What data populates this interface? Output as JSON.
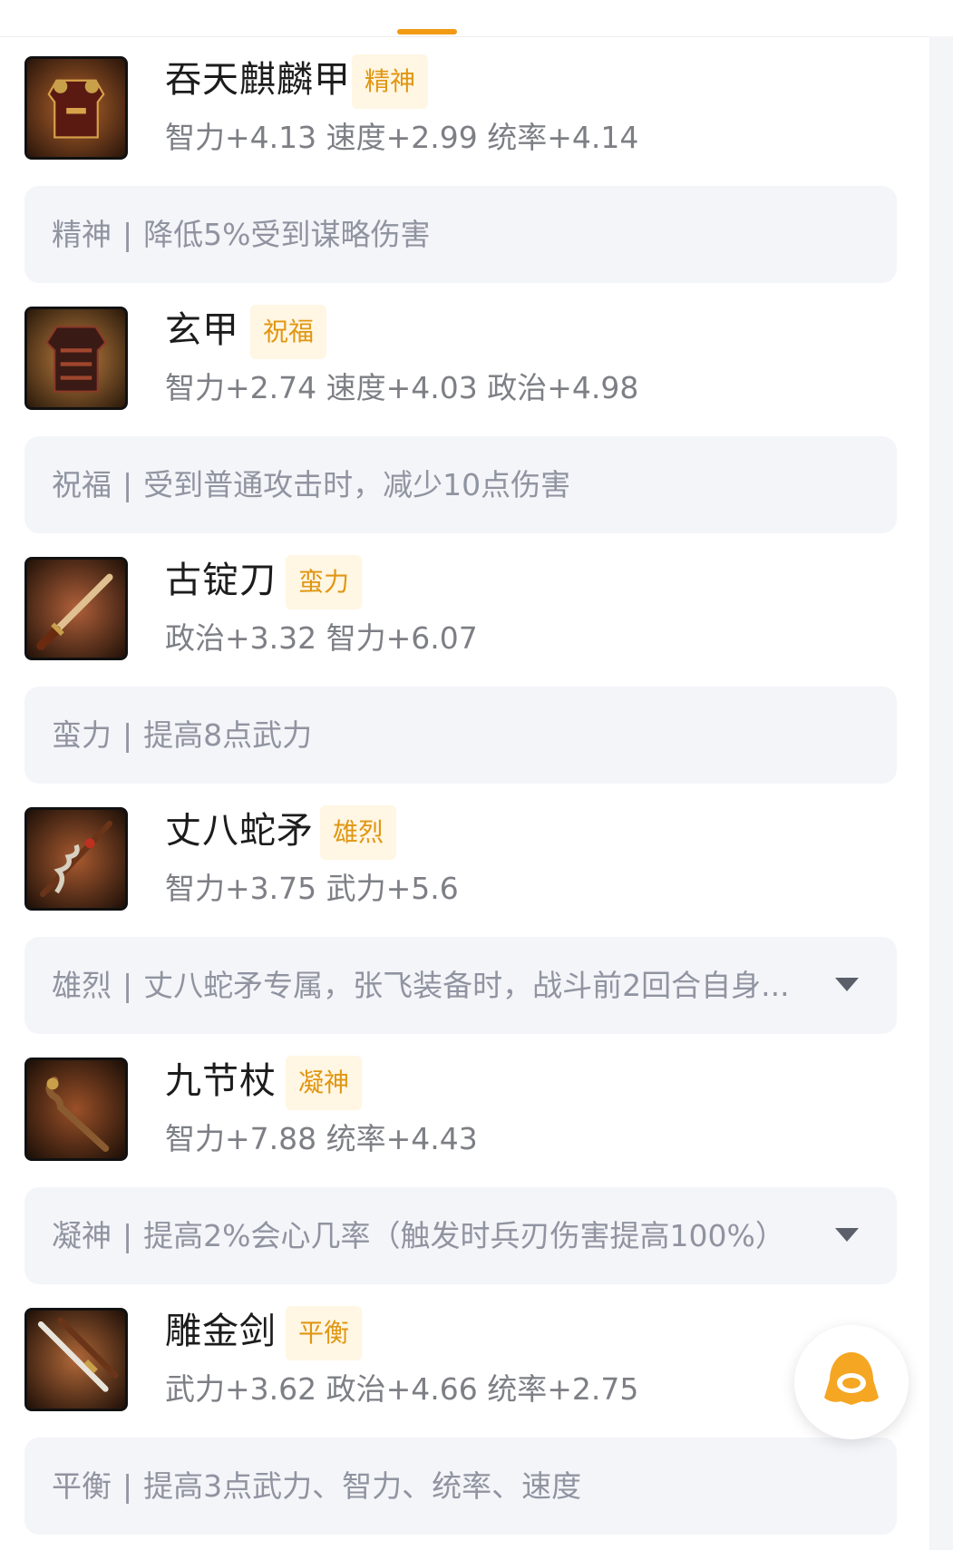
{
  "colors": {
    "accent": "#f29a12",
    "badge_bg": "#fff6e3",
    "badge_text": "#e09612",
    "desc_bg": "#f3f5f9",
    "stat_text": "#7d7f85",
    "title_text": "#1c1c1c"
  },
  "items": [
    {
      "name": "吞天麒麟甲",
      "badge": "精神",
      "stats": "智力+4.13 速度+2.99 统率+4.14",
      "desc_label": "精神",
      "desc_text": "降低5%受到谋略伤害",
      "icon": "armor-icon",
      "expandable": false
    },
    {
      "name": "玄甲",
      "badge": "祝福",
      "stats": "智力+2.74 速度+4.03 政治+4.98",
      "desc_label": "祝福",
      "desc_text": "受到普通攻击时，减少10点伤害",
      "icon": "armor-icon",
      "expandable": false
    },
    {
      "name": "古锭刀",
      "badge": "蛮力",
      "stats": "政治+3.32 智力+6.07",
      "desc_label": "蛮力",
      "desc_text": "提高8点武力",
      "icon": "sword-icon",
      "expandable": false
    },
    {
      "name": "丈八蛇矛",
      "badge": "雄烈",
      "stats": "智力+3.75 武力+5.6",
      "desc_label": "雄烈",
      "desc_text": "丈八蛇矛专属，张飞装备时，战斗前2回合自身...",
      "icon": "spear-icon",
      "expandable": true
    },
    {
      "name": "九节杖",
      "badge": "凝神",
      "stats": "智力+7.88 统率+4.43",
      "desc_label": "凝神",
      "desc_text": "提高2%会心几率（触发时兵刃伤害提高100%）",
      "icon": "staff-icon",
      "expandable": true
    },
    {
      "name": "雕金剑",
      "badge": "平衡",
      "stats": "武力+3.62 政治+4.66 统率+2.75",
      "desc_label": "平衡",
      "desc_text": "提高3点武力、智力、统率、速度",
      "icon": "sword-icon",
      "expandable": false
    }
  ],
  "fab": {
    "icon": "assistant-icon"
  },
  "separator": "|"
}
